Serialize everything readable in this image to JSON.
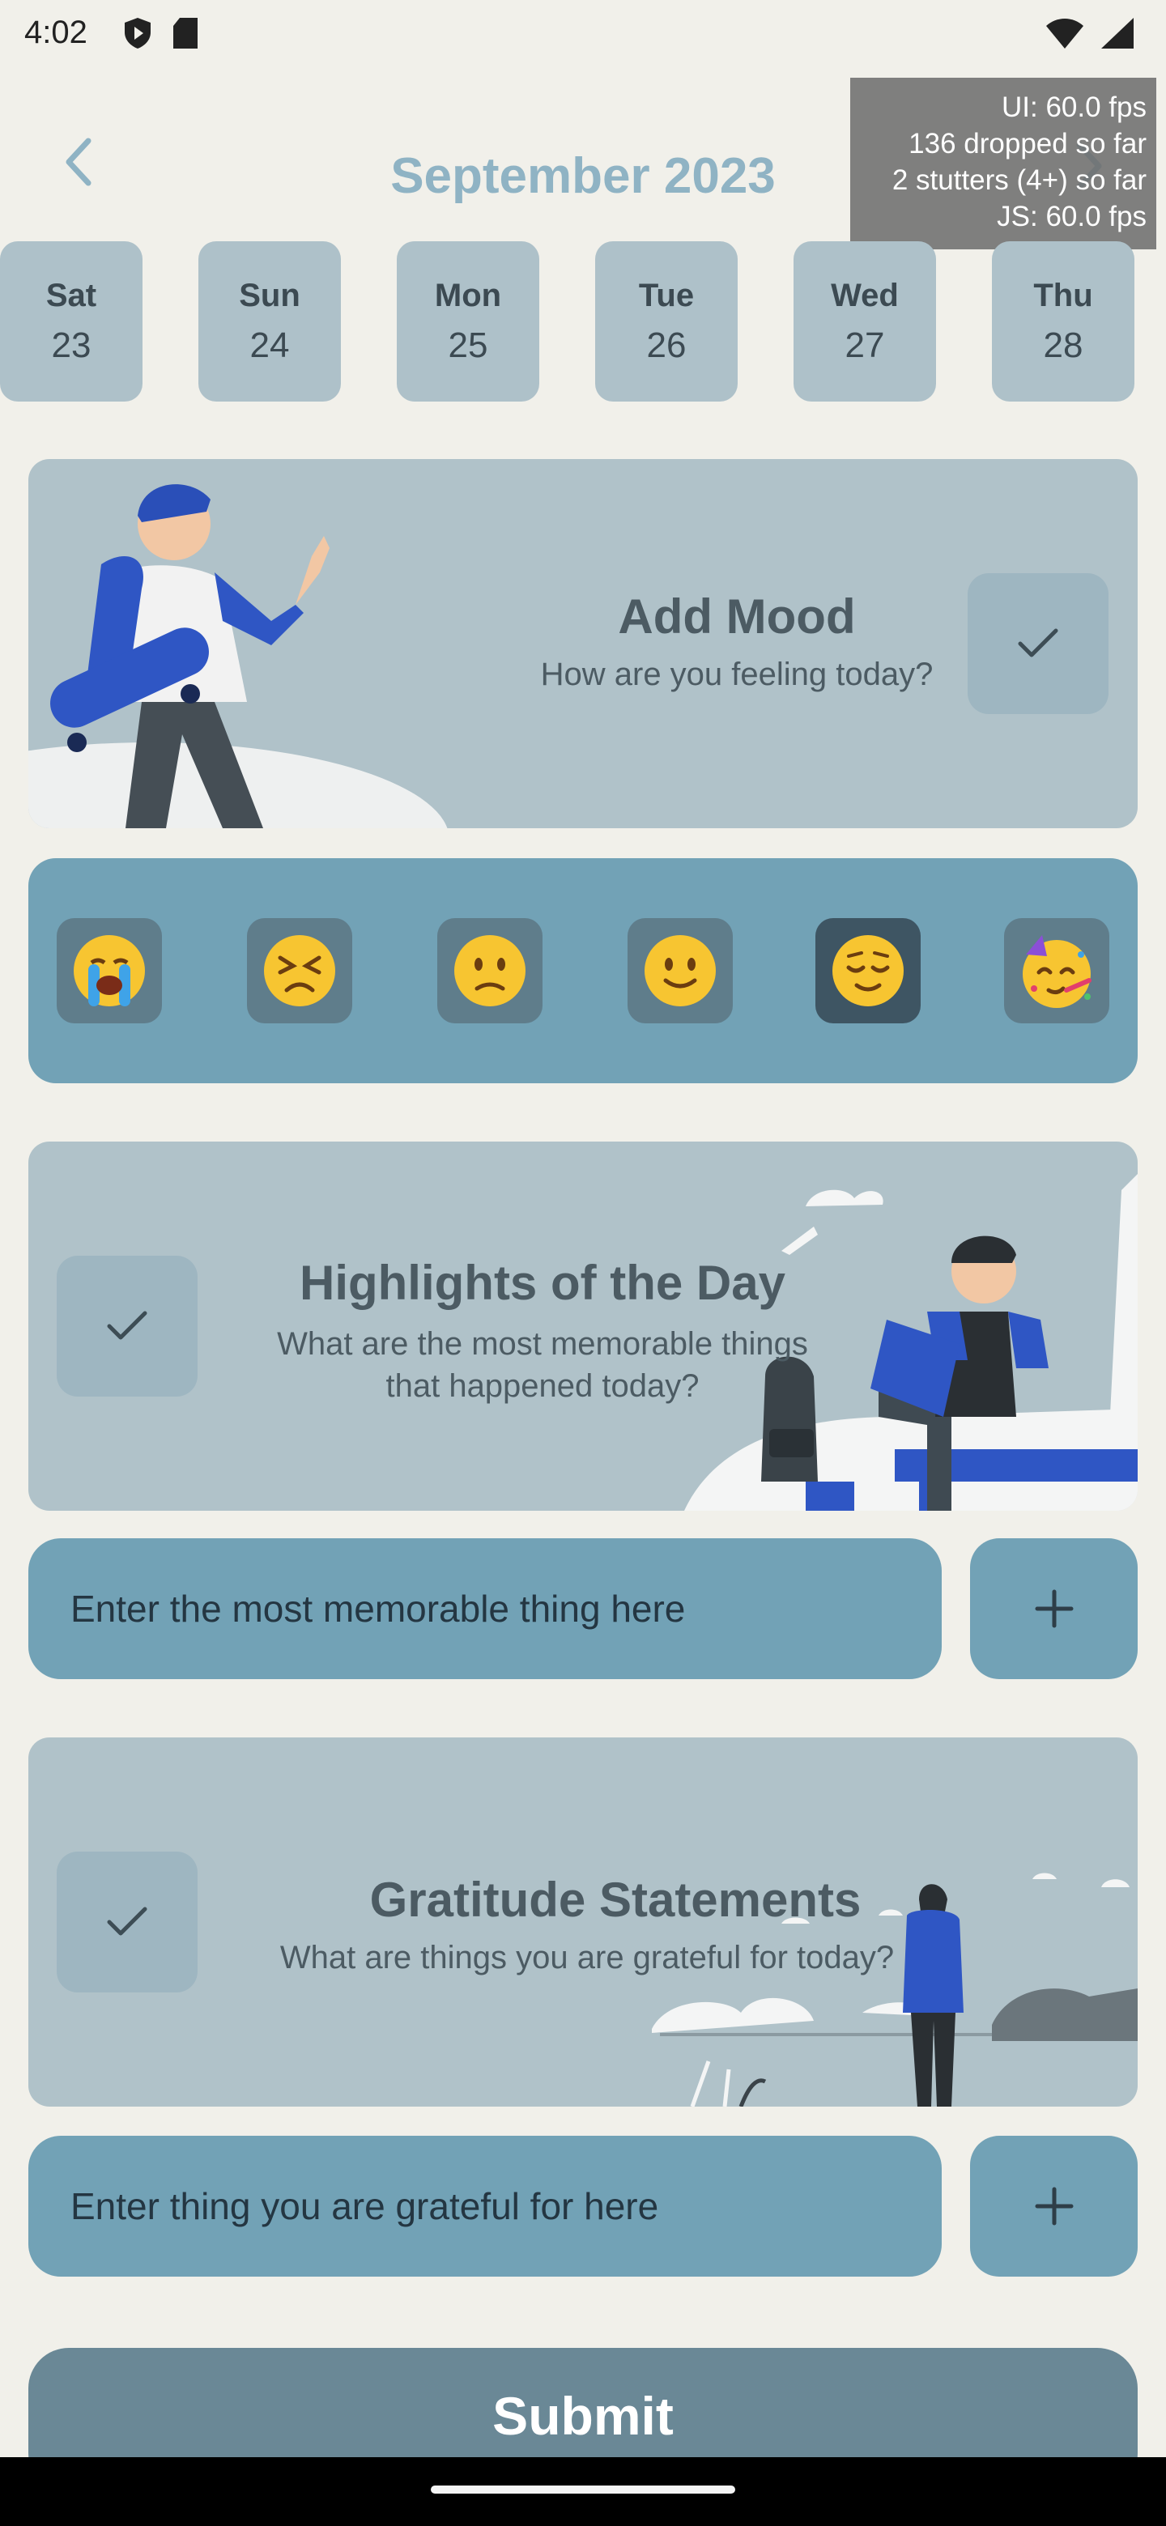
{
  "status_bar": {
    "time": "4:02"
  },
  "header": {
    "month_title": "September 2023"
  },
  "perf_overlay": {
    "lines": [
      "UI: 60.0 fps",
      "136 dropped so far",
      "2 stutters (4+) so far",
      "JS: 60.0 fps"
    ]
  },
  "days": [
    {
      "name": "Sat",
      "num": "23"
    },
    {
      "name": "Sun",
      "num": "24"
    },
    {
      "name": "Mon",
      "num": "25"
    },
    {
      "name": "Tue",
      "num": "26"
    },
    {
      "name": "Wed",
      "num": "27"
    },
    {
      "name": "Thu",
      "num": "28"
    }
  ],
  "mood_card": {
    "title": "Add Mood",
    "subtitle": "How are you feeling today?"
  },
  "moods": [
    {
      "icon": "crying-face-icon",
      "selected": false
    },
    {
      "icon": "persevering-face-icon",
      "selected": false
    },
    {
      "icon": "slightly-frowning-face-icon",
      "selected": false
    },
    {
      "icon": "slightly-smiling-face-icon",
      "selected": false
    },
    {
      "icon": "relieved-face-icon",
      "selected": true
    },
    {
      "icon": "partying-face-icon",
      "selected": false
    }
  ],
  "highlights_card": {
    "title": "Highlights of the Day",
    "subtitle_line1": "What are the most memorable things",
    "subtitle_line2": "that happened today?"
  },
  "highlights_input": {
    "placeholder": "Enter the most memorable thing here"
  },
  "gratitude_card": {
    "title": "Gratitude Statements",
    "subtitle": "What are things you are grateful for today?"
  },
  "gratitude_input": {
    "placeholder": "Enter thing you are grateful for here"
  },
  "submit": {
    "label": "Submit"
  },
  "colors": {
    "background": "#f1f0ea",
    "card": "#b0c2c9",
    "accent": "#72a2b6",
    "title_blue": "#8fb3c4",
    "submit": "#6a8896"
  }
}
